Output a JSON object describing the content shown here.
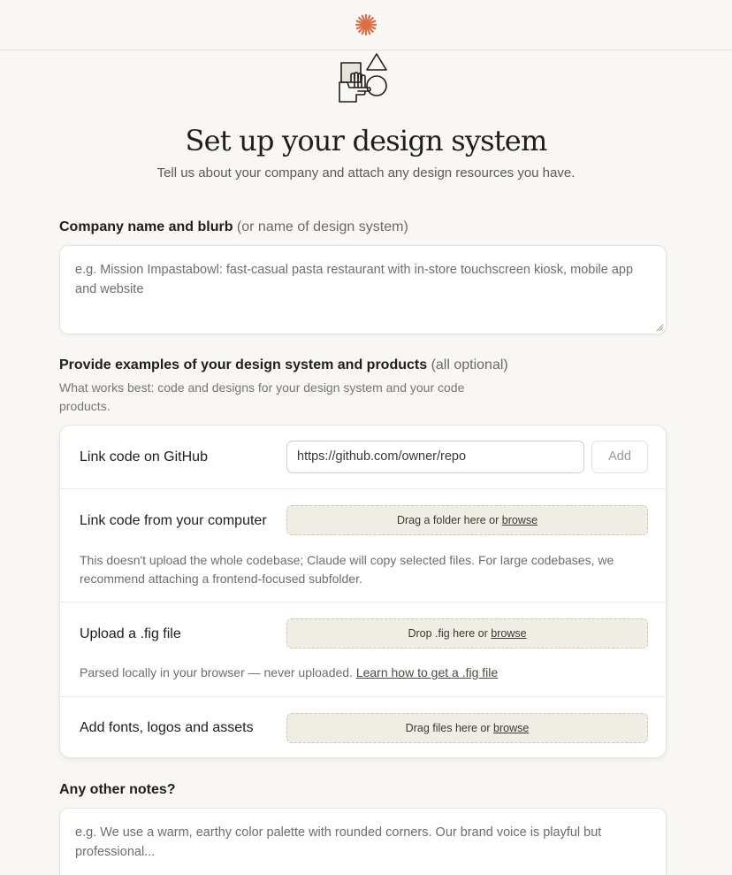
{
  "header": {
    "logo_icon": "asterisk-logo-icon",
    "accent_color": "#d9704a"
  },
  "hero": {
    "illustration_icon": "shapes-hand-illustration-icon",
    "title": "Set up your design system",
    "subtitle": "Tell us about your company and attach any design resources you have."
  },
  "company": {
    "label": "Company name and blurb",
    "label_hint": "(or name of design system)",
    "placeholder": "e.g. Mission Impastabowl: fast-casual pasta restaurant with in-store touchscreen kiosk, mobile app and website"
  },
  "examples": {
    "label": "Provide examples of your design system and products",
    "label_hint": "(all optional)",
    "help": "What works best: code and designs for your design system and your code products.",
    "github": {
      "label": "Link code on GitHub",
      "url_value": "https://github.com/owner/repo",
      "add_label": "Add"
    },
    "computer": {
      "label": "Link code from your computer",
      "drop_text": "Drag a folder here or",
      "browse_label": "browse",
      "note": "This doesn't upload the whole codebase; Claude will copy selected files. For large codebases, we recommend attaching a frontend-focused subfolder."
    },
    "fig": {
      "label": "Upload a .fig file",
      "drop_text": "Drop .fig here or",
      "browse_label": "browse",
      "note": "Parsed locally in your browser — never uploaded.",
      "learn_link": "Learn how to get a .fig file"
    },
    "assets": {
      "label": "Add fonts, logos and assets",
      "drop_text": "Drag files here or",
      "browse_label": "browse"
    }
  },
  "notes": {
    "label": "Any other notes?",
    "placeholder": "e.g. We use a warm, earthy color palette with rounded corners. Our brand voice is playful but professional..."
  }
}
